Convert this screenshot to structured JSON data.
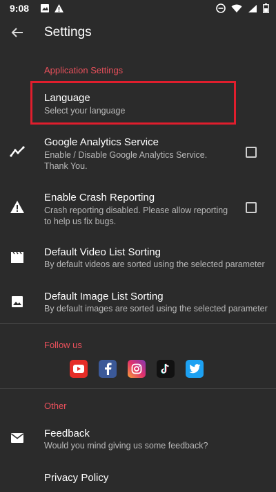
{
  "status_bar": {
    "time": "9:08"
  },
  "app_bar": {
    "title": "Settings"
  },
  "sections": {
    "application": "Application Settings",
    "follow": "Follow us",
    "other": "Other"
  },
  "items": {
    "language": {
      "title": "Language",
      "subtitle": "Select your language"
    },
    "analytics": {
      "title": "Google Analytics Service",
      "subtitle_1": "Enable / Disable Google Analytics Service.",
      "subtitle_2": "Thank You."
    },
    "crash": {
      "title": "Enable Crash Reporting",
      "subtitle_1": "Crash reporting disabled. Please allow reporting",
      "subtitle_2": "to help us fix bugs."
    },
    "video_sort": {
      "title": "Default Video List Sorting",
      "subtitle": "By default videos are sorted using the selected parameter"
    },
    "image_sort": {
      "title": "Default Image List Sorting",
      "subtitle": "By default images are sorted using the selected parameter"
    },
    "feedback": {
      "title": "Feedback",
      "subtitle": "Would you mind giving us some feedback?"
    },
    "privacy": {
      "title": "Privacy Policy"
    }
  },
  "checkboxes": {
    "analytics_checked": false,
    "crash_checked": false
  },
  "social_icons": [
    "youtube-icon",
    "facebook-icon",
    "instagram-icon",
    "tiktok-icon",
    "twitter-icon"
  ],
  "colors": {
    "background": "#2b2b2b",
    "accent": "#e8505b",
    "highlight": "#e01e2d"
  }
}
